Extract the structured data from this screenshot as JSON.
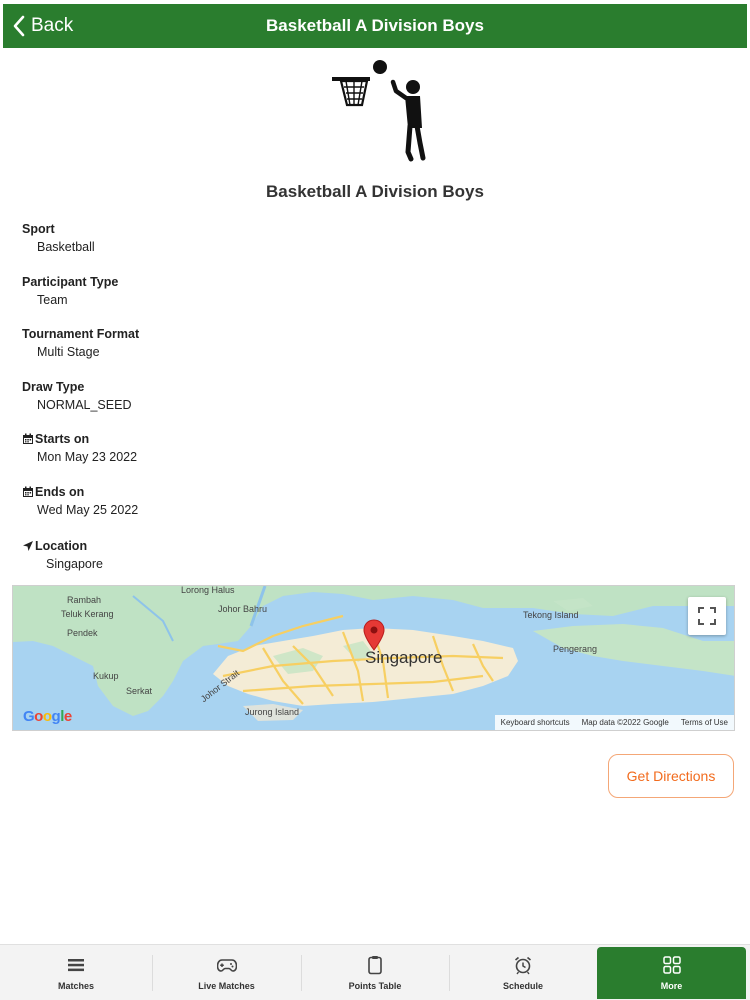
{
  "header": {
    "back_label": "Back",
    "title": "Basketball A Division Boys"
  },
  "event": {
    "icon": "basketball-player-icon",
    "title": "Basketball A Division Boys"
  },
  "details": {
    "sport": {
      "label": "Sport",
      "value": "Basketball"
    },
    "participant_type": {
      "label": "Participant Type",
      "value": "Team"
    },
    "tournament_format": {
      "label": "Tournament Format",
      "value": "Multi Stage"
    },
    "draw_type": {
      "label": "Draw Type",
      "value": "NORMAL_SEED"
    },
    "starts_on": {
      "label": "Starts on",
      "value": "Mon May 23 2022",
      "icon": "calendar-icon"
    },
    "ends_on": {
      "label": "Ends on",
      "value": "Wed May 25 2022",
      "icon": "calendar-icon"
    },
    "location": {
      "label": "Location",
      "value": "Singapore",
      "icon": "location-arrow-icon"
    }
  },
  "map": {
    "city": "Singapore",
    "labels": [
      "Lorong Halus",
      "Rambah",
      "Teluk Kerang",
      "Pendek",
      "Kukup",
      "Serkat",
      "Johor Strait",
      "Jurong Island",
      "Tekong Island",
      "Pengerang",
      "Johor Bahru"
    ],
    "attribution": {
      "shortcuts": "Keyboard shortcuts",
      "map_data": "Map data ©2022 Google",
      "terms": "Terms of Use"
    },
    "logo": "Google"
  },
  "actions": {
    "directions_label": "Get Directions"
  },
  "bottom_nav": {
    "items": [
      {
        "label": "Matches",
        "icon": "list-icon"
      },
      {
        "label": "Live Matches",
        "icon": "gamepad-icon"
      },
      {
        "label": "Points Table",
        "icon": "clipboard-icon"
      },
      {
        "label": "Schedule",
        "icon": "alarm-clock-icon"
      },
      {
        "label": "More",
        "icon": "grid-icon"
      }
    ],
    "active": "More"
  },
  "colors": {
    "brand_green": "#2a7d2e",
    "accent_orange": "#f26b1d",
    "map_pin": "#e53935"
  }
}
